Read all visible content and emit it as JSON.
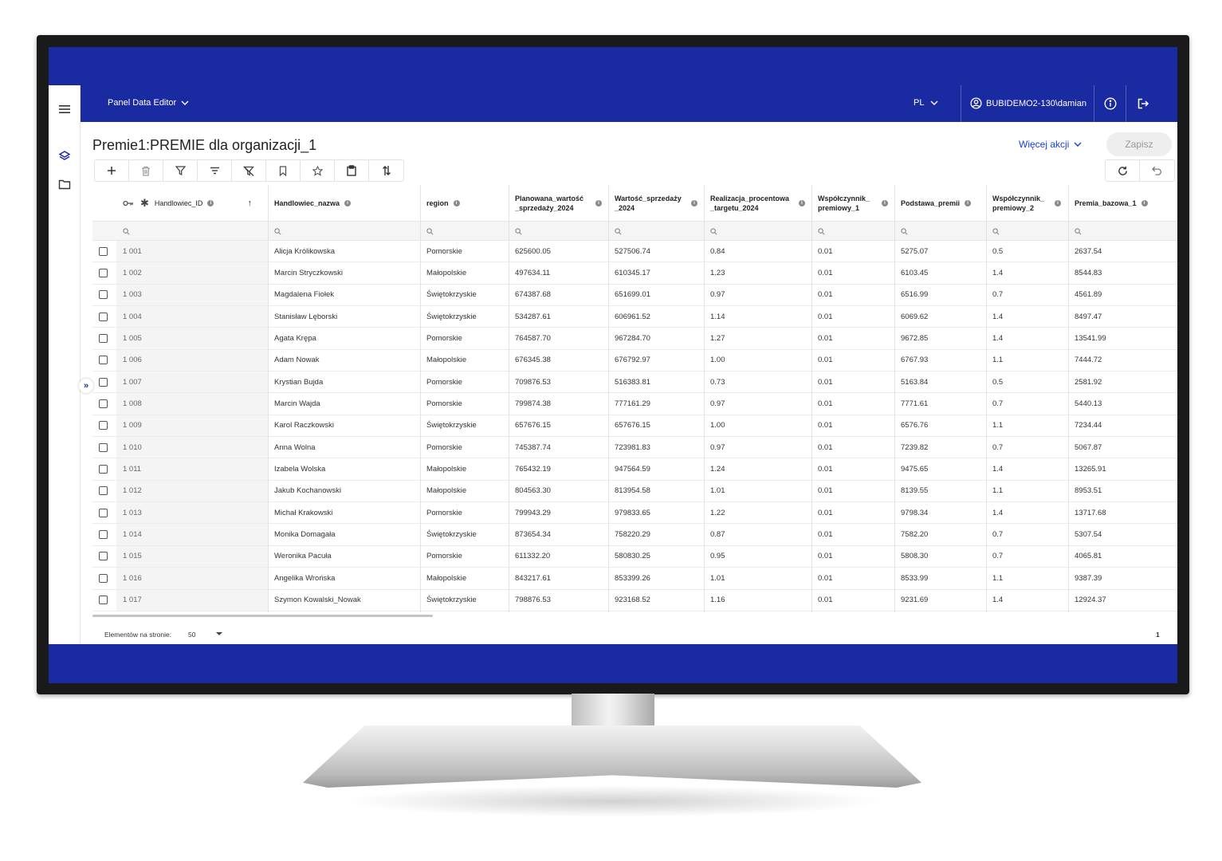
{
  "topbar": {
    "app_title": "Panel Data Editor",
    "language": "PL",
    "user": "BUBIDEMO2-130\\damian"
  },
  "page": {
    "title": "Premie1:PREMIE dla organizacji_1",
    "more_actions": "Więcej akcji",
    "save": "Zapisz"
  },
  "toolbar": [
    "add-icon",
    "delete-icon",
    "filter-icon",
    "filter-lines-icon",
    "clear-filter-icon",
    "bookmark-icon",
    "star-icon",
    "clipboard-icon",
    "sort-swap-icon"
  ],
  "columns": [
    {
      "label": "Handlowiec_ID"
    },
    {
      "label": "Handlowiec_nazwa"
    },
    {
      "label": "region"
    },
    {
      "label": "Planowana_wartość _sprzedaży_2024"
    },
    {
      "label": "Wartość_sprzedaży _2024"
    },
    {
      "label": "Realizacja_procentowa _targetu_2024"
    },
    {
      "label": "Współczynnik_ premiowy_1"
    },
    {
      "label": "Podstawa_premii"
    },
    {
      "label": "Współczynnik_ premiowy_2"
    },
    {
      "label": "Premia_bazowa_1"
    }
  ],
  "rows": [
    [
      "1 001",
      "Alicja Królikowska",
      "Pomorskie",
      "625600.05",
      "527506.74",
      "0.84",
      "0.01",
      "5275.07",
      "0.5",
      "2637.54"
    ],
    [
      "1 002",
      "Marcin Stryczkowski",
      "Małopolskie",
      "497634.11",
      "610345.17",
      "1.23",
      "0.01",
      "6103.45",
      "1.4",
      "8544.83"
    ],
    [
      "1 003",
      "Magdalena Fiołek",
      "Świętokrzyskie",
      "674387.68",
      "651699.01",
      "0.97",
      "0.01",
      "6516.99",
      "0.7",
      "4561.89"
    ],
    [
      "1 004",
      "Stanisław Lęborski",
      "Świętokrzyskie",
      "534287.61",
      "606961.52",
      "1.14",
      "0.01",
      "6069.62",
      "1.4",
      "8497.47"
    ],
    [
      "1 005",
      "Agata Krępa",
      "Pomorskie",
      "764587.70",
      "967284.70",
      "1.27",
      "0.01",
      "9672.85",
      "1.4",
      "13541.99"
    ],
    [
      "1 006",
      "Adam Nowak",
      "Małopolskie",
      "676345.38",
      "676792.97",
      "1.00",
      "0.01",
      "6767.93",
      "1.1",
      "7444.72"
    ],
    [
      "1 007",
      "Krystian Bujda",
      "Pomorskie",
      "709876.53",
      "516383.81",
      "0.73",
      "0.01",
      "5163.84",
      "0.5",
      "2581.92"
    ],
    [
      "1 008",
      "Marcin Wajda",
      "Pomorskie",
      "799874.38",
      "777161.29",
      "0.97",
      "0.01",
      "7771.61",
      "0.7",
      "5440.13"
    ],
    [
      "1 009",
      "Karol Raczkowski",
      "Świętokrzyskie",
      "657676.15",
      "657676.15",
      "1.00",
      "0.01",
      "6576.76",
      "1.1",
      "7234.44"
    ],
    [
      "1 010",
      "Anna Wolna",
      "Pomorskie",
      "745387.74",
      "723981.83",
      "0.97",
      "0.01",
      "7239.82",
      "0.7",
      "5067.87"
    ],
    [
      "1 011",
      "Izabela Wolska",
      "Małopolskie",
      "765432.19",
      "947564.59",
      "1.24",
      "0.01",
      "9475.65",
      "1.4",
      "13265.91"
    ],
    [
      "1 012",
      "Jakub Kochanowski",
      "Małopolskie",
      "804563.30",
      "813954.58",
      "1.01",
      "0.01",
      "8139.55",
      "1.1",
      "8953.51"
    ],
    [
      "1 013",
      "Michał Krakowski",
      "Pomorskie",
      "799943.29",
      "979833.65",
      "1.22",
      "0.01",
      "9798.34",
      "1.4",
      "13717.68"
    ],
    [
      "1 014",
      "Monika Domagała",
      "Świętokrzyskie",
      "873654.34",
      "758220.29",
      "0.87",
      "0.01",
      "7582.20",
      "0.7",
      "5307.54"
    ],
    [
      "1 015",
      "Weronika Pacuła",
      "Pomorskie",
      "611332.20",
      "580830.25",
      "0.95",
      "0.01",
      "5808.30",
      "0.7",
      "4065.81"
    ],
    [
      "1 016",
      "Angelika Wrońska",
      "Małopolskie",
      "843217.61",
      "853399.26",
      "1.01",
      "0.01",
      "8533.99",
      "1.1",
      "9387.39"
    ],
    [
      "1 017",
      "Szymon Kowalski_Nowak",
      "Świętokrzyskie",
      "798876.53",
      "923168.52",
      "1.16",
      "0.01",
      "9231.69",
      "1.4",
      "12924.37"
    ]
  ],
  "footer": {
    "per_page_label": "Elementów na stronie:",
    "per_page_value": "50",
    "page": "1"
  },
  "colors": {
    "brand": "#1a2aa0",
    "link": "#1a3fd1"
  }
}
